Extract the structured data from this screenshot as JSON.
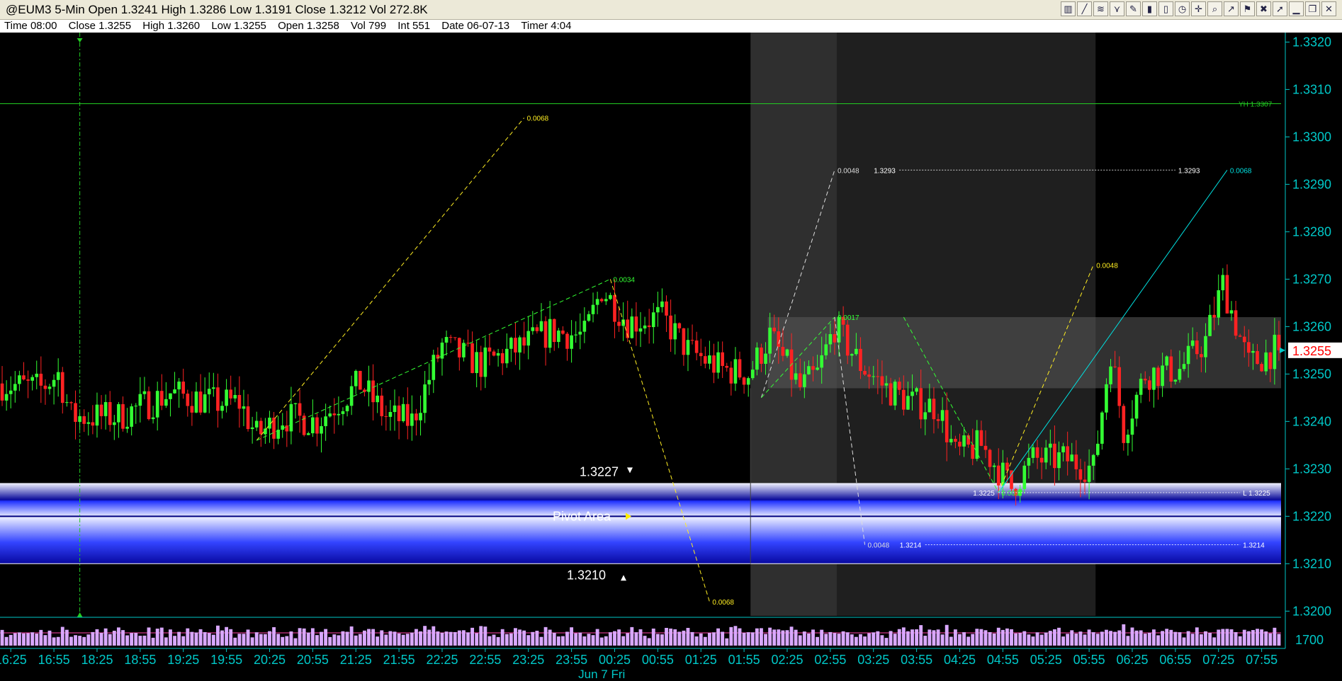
{
  "window": {
    "title": "@EUM3 5-Min Open 1.3241 High 1.3286 Low 1.3191 Close 1.3212 Vol 272.8K",
    "toolbar_icons": [
      "bar-chart-icon",
      "line-icon",
      "fib-icon",
      "pitchfork-icon",
      "pencil-icon",
      "bar-icon",
      "candle-icon",
      "clock-icon",
      "crosshair-icon",
      "zoom-icon",
      "trend-icon",
      "marker-icon",
      "delete-icon",
      "cursor-icon",
      "minimize-icon",
      "restore-icon",
      "close-icon"
    ]
  },
  "infobar": {
    "time": "Time 08:00",
    "close": "Close 1.3255",
    "high": "High 1.3260",
    "low": "Low 1.3255",
    "open": "Open 1.3258",
    "vol": "Vol 799",
    "int": "Int 551",
    "date": "Date 06-07-13",
    "timer": "Timer 4:04"
  },
  "colors": {
    "background": "#000000",
    "up_candle": "#33ff33",
    "down_candle": "#ff2222",
    "axis": "#00c8c8",
    "pivot_band": "#3a4dff",
    "session_shade": "#262626",
    "volume": "#d9a8ff"
  },
  "chart_data": {
    "type": "candlestick",
    "ylim": [
      1.3199,
      1.3322
    ],
    "y_ticks": [
      "1.3320",
      "1.3310",
      "1.3300",
      "1.3290",
      "1.3280",
      "1.3270",
      "1.3260",
      "1.3250",
      "1.3240",
      "1.3230",
      "1.3220",
      "1.3210",
      "1.3200"
    ],
    "volume_tick": "1700",
    "x_ticks": [
      {
        "bar": 2,
        "label": "16:25"
      },
      {
        "bar": 12,
        "label": "16:55"
      },
      {
        "bar": 22,
        "label": "18:25"
      },
      {
        "bar": 32,
        "label": "18:55"
      },
      {
        "bar": 42,
        "label": "19:25"
      },
      {
        "bar": 52,
        "label": "19:55"
      },
      {
        "bar": 62,
        "label": "20:25"
      },
      {
        "bar": 72,
        "label": "20:55"
      },
      {
        "bar": 82,
        "label": "21:25"
      },
      {
        "bar": 92,
        "label": "21:55"
      },
      {
        "bar": 102,
        "label": "22:25"
      },
      {
        "bar": 112,
        "label": "22:55"
      },
      {
        "bar": 122,
        "label": "23:25"
      },
      {
        "bar": 132,
        "label": "23:55"
      },
      {
        "bar": 142,
        "label": "00:25"
      },
      {
        "bar": 152,
        "label": "00:55"
      },
      {
        "bar": 162,
        "label": "01:25"
      },
      {
        "bar": 172,
        "label": "01:55"
      },
      {
        "bar": 182,
        "label": "02:25"
      },
      {
        "bar": 192,
        "label": "02:55"
      },
      {
        "bar": 202,
        "label": "03:25"
      },
      {
        "bar": 212,
        "label": "03:55"
      },
      {
        "bar": 222,
        "label": "04:25"
      },
      {
        "bar": 232,
        "label": "04:55"
      },
      {
        "bar": 242,
        "label": "05:25"
      },
      {
        "bar": 252,
        "label": "05:55"
      },
      {
        "bar": 262,
        "label": "06:25"
      },
      {
        "bar": 272,
        "label": "06:55"
      },
      {
        "bar": 282,
        "label": "07:25"
      },
      {
        "bar": 292,
        "label": "07:55"
      }
    ],
    "date_label": "Jun 7 Fri",
    "bar_count": 297,
    "waypoints": [
      {
        "bar": 0,
        "price": 1.3248
      },
      {
        "bar": 10,
        "price": 1.3247
      },
      {
        "bar": 14,
        "price": 1.325
      },
      {
        "bar": 17,
        "price": 1.3241
      },
      {
        "bar": 28,
        "price": 1.3241
      },
      {
        "bar": 40,
        "price": 1.3246
      },
      {
        "bar": 50,
        "price": 1.3244
      },
      {
        "bar": 56,
        "price": 1.3244
      },
      {
        "bar": 60,
        "price": 1.3237
      },
      {
        "bar": 66,
        "price": 1.3241
      },
      {
        "bar": 74,
        "price": 1.324
      },
      {
        "bar": 84,
        "price": 1.3248
      },
      {
        "bar": 90,
        "price": 1.3241
      },
      {
        "bar": 96,
        "price": 1.324
      },
      {
        "bar": 103,
        "price": 1.3256
      },
      {
        "bar": 112,
        "price": 1.3252
      },
      {
        "bar": 122,
        "price": 1.3256
      },
      {
        "bar": 128,
        "price": 1.3259
      },
      {
        "bar": 136,
        "price": 1.3258
      },
      {
        "bar": 140,
        "price": 1.3268
      },
      {
        "bar": 146,
        "price": 1.3261
      },
      {
        "bar": 154,
        "price": 1.3262
      },
      {
        "bar": 160,
        "price": 1.3255
      },
      {
        "bar": 168,
        "price": 1.3251
      },
      {
        "bar": 174,
        "price": 1.325
      },
      {
        "bar": 179,
        "price": 1.3258
      },
      {
        "bar": 186,
        "price": 1.3247
      },
      {
        "bar": 190,
        "price": 1.325
      },
      {
        "bar": 194,
        "price": 1.326
      },
      {
        "bar": 200,
        "price": 1.3252
      },
      {
        "bar": 206,
        "price": 1.3247
      },
      {
        "bar": 212,
        "price": 1.3244
      },
      {
        "bar": 218,
        "price": 1.3243
      },
      {
        "bar": 222,
        "price": 1.3233
      },
      {
        "bar": 228,
        "price": 1.3235
      },
      {
        "bar": 235,
        "price": 1.3226
      },
      {
        "bar": 240,
        "price": 1.3232
      },
      {
        "bar": 248,
        "price": 1.3232
      },
      {
        "bar": 254,
        "price": 1.323
      },
      {
        "bar": 258,
        "price": 1.3255
      },
      {
        "bar": 261,
        "price": 1.3238
      },
      {
        "bar": 266,
        "price": 1.325
      },
      {
        "bar": 274,
        "price": 1.3251
      },
      {
        "bar": 280,
        "price": 1.3257
      },
      {
        "bar": 284,
        "price": 1.3269
      },
      {
        "bar": 290,
        "price": 1.3252
      },
      {
        "bar": 296,
        "price": 1.3255
      }
    ],
    "current_price": "1.3255",
    "yesterday_high": {
      "price": 1.3307,
      "label": "YH 1.3307"
    },
    "pivot_area": {
      "top": 1.3227,
      "mid": 1.322,
      "bottom": 1.321,
      "label": "Pivot Area",
      "top_label": "1.3227",
      "bottom_label": "1.3210"
    },
    "consolidation_box": {
      "bar_start": 178,
      "bar_end": 297,
      "top": 1.3262,
      "bottom": 1.3247
    },
    "session_shade": [
      {
        "bar_start": 174,
        "bar_end": 194
      },
      {
        "bar_start": 194,
        "bar_end": 254
      }
    ],
    "vertical_marker_bar": 18,
    "measured_moves": [
      {
        "from": [
          59,
          1.3236
        ],
        "to": [
          121,
          1.3304
        ],
        "label": "0.0068",
        "color": "#ffee22"
      },
      {
        "from": [
          59,
          1.3236
        ],
        "to": [
          141,
          1.327
        ],
        "label": "0.0034",
        "color": "#33ff33"
      },
      {
        "from": [
          141,
          1.327
        ],
        "to": [
          164,
          1.3202
        ],
        "label": "0.0068",
        "color": "#ffee22"
      },
      {
        "from": [
          176,
          1.3245
        ],
        "to": [
          193,
          1.3293
        ],
        "label": "0.0048",
        "color": "#dddddd"
      },
      {
        "from": [
          176,
          1.3245
        ],
        "to": [
          193,
          1.3262
        ],
        "label": "0.0017",
        "color": "#33ff33"
      },
      {
        "from": [
          193,
          1.3262
        ],
        "to": [
          200,
          1.3214
        ],
        "label": "0.0048",
        "color": "#dddddd"
      },
      {
        "from": [
          209,
          1.3262
        ],
        "to": [
          231,
          1.3225
        ],
        "label": "0.0037",
        "color": "#33ff33"
      },
      {
        "from": [
          231,
          1.3225
        ],
        "to": [
          253,
          1.3273
        ],
        "label": "0.0048",
        "color": "#ffee22"
      },
      {
        "from": [
          231,
          1.3225
        ],
        "to": [
          284,
          1.3293
        ],
        "label": "0.0068",
        "color": "#00e0e0"
      }
    ],
    "level_lines": [
      {
        "price": 1.3293,
        "from_bar": 208,
        "to_bar": 272,
        "label": "1.3293",
        "color": "#ffffff"
      },
      {
        "price": 1.3225,
        "from_bar": 231,
        "to_bar": 287,
        "label": "L 1.3225",
        "color": "#ffffff"
      },
      {
        "price": 1.3214,
        "from_bar": 214,
        "to_bar": 287,
        "label": "1.3214",
        "color": "#ffffff"
      }
    ]
  }
}
